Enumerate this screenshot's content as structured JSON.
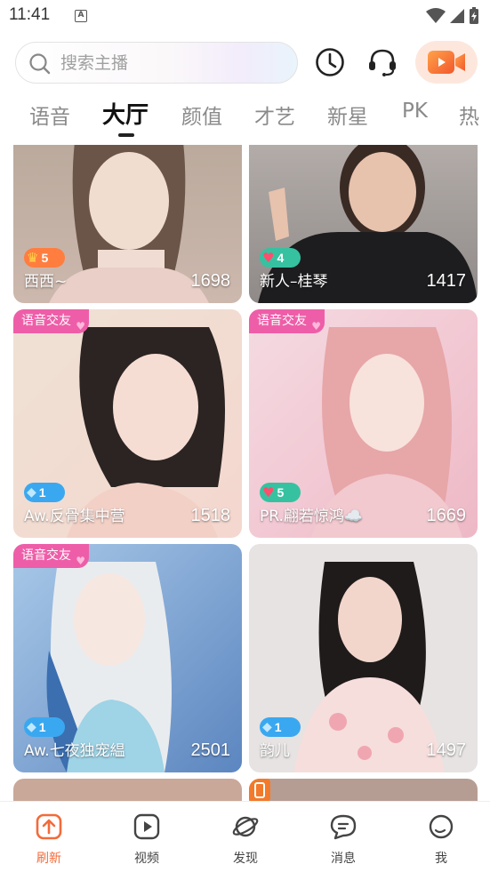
{
  "status_bar": {
    "time": "11:41",
    "notif_icon": "A"
  },
  "header": {
    "search_placeholder": "搜索主播",
    "icons": [
      "search-icon",
      "history-clock-icon",
      "headset-icon",
      "video-camera-icon"
    ],
    "accent": "#f26b3a"
  },
  "tabs": [
    {
      "label": "语音"
    },
    {
      "label": "大厅",
      "active": true
    },
    {
      "label": "颜值"
    },
    {
      "label": "才艺"
    },
    {
      "label": "新星"
    },
    {
      "label": "PK"
    },
    {
      "label": "热"
    }
  ],
  "cards": [
    {
      "name": "西西~",
      "count": "1698",
      "level": "5",
      "badge": "crown"
    },
    {
      "name": "新人–桂琴",
      "count": "1417",
      "level": "4",
      "badge": "heart"
    },
    {
      "name": "Aw.反骨集中营",
      "count": "1518",
      "level": "1",
      "badge": "diamond",
      "tag": "语音交友"
    },
    {
      "name": "PR.翩若惊鸿☁️",
      "count": "1669",
      "level": "5",
      "badge": "heart",
      "tag": "语音交友"
    },
    {
      "name": "Aw.七夜独宠緼",
      "count": "2501",
      "level": "1",
      "badge": "diamond",
      "tag": "语音交友"
    },
    {
      "name": "韵儿",
      "count": "1497",
      "level": "1",
      "badge": "diamond"
    }
  ],
  "bottom_nav": [
    {
      "label": "刷新",
      "icon": "refresh-icon",
      "active": true
    },
    {
      "label": "视频",
      "icon": "video-play-icon"
    },
    {
      "label": "发现",
      "icon": "planet-icon"
    },
    {
      "label": "消息",
      "icon": "message-icon"
    },
    {
      "label": "我",
      "icon": "profile-icon"
    }
  ]
}
